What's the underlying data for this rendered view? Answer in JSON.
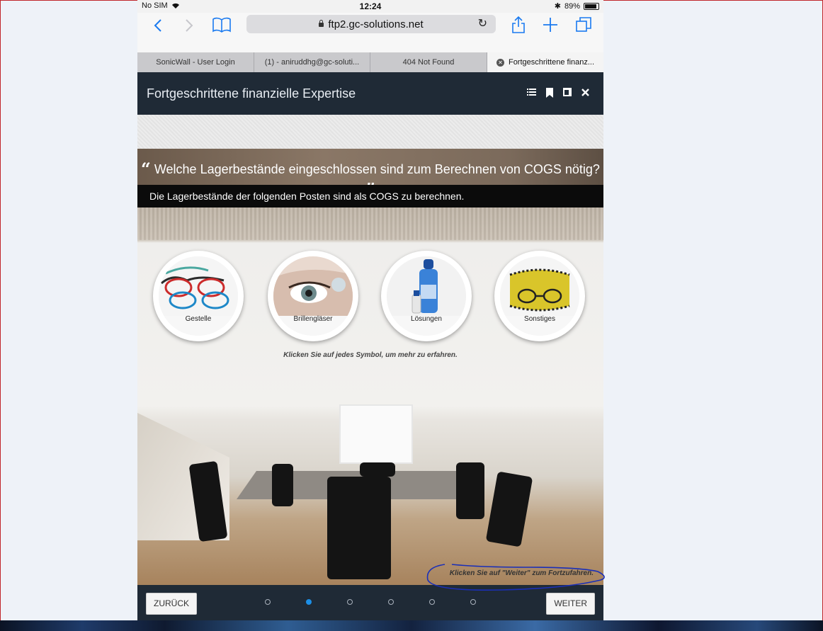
{
  "status": {
    "carrier": "No SIM",
    "time": "12:24",
    "battery": "89%"
  },
  "browser": {
    "url": "ftp2.gc-solutions.net",
    "tabs": [
      {
        "label": "SonicWall - User Login"
      },
      {
        "label": "(1) - aniruddhg@gc-soluti..."
      },
      {
        "label": "404 Not Found"
      },
      {
        "label": "Fortgeschrittene finanz..."
      }
    ],
    "icons": {
      "back": "chevron-left-icon",
      "forward": "chevron-right-icon",
      "bookmarks": "book-icon",
      "share": "share-icon",
      "new_tab": "plus-icon",
      "tabs": "tabs-icon",
      "reload": "reload-icon"
    }
  },
  "course": {
    "title": "Fortgeschrittene finanzielle Expertise",
    "header_icons": [
      "list-icon",
      "bookmark-icon",
      "page-icon",
      "close-icon"
    ]
  },
  "slide": {
    "question": "Welche Lagerbestände eingeschlossen sind zum Berechnen von COGS nötig?",
    "subheader": "Die Lagerbestände der folgenden Posten sind als COGS zu berechnen.",
    "items": [
      {
        "label": "Gestelle",
        "icon": "eyeglass-frames-icon"
      },
      {
        "label": "Brillengläser",
        "icon": "contact-lens-icon"
      },
      {
        "label": "Lösungen",
        "icon": "solution-bottle-icon"
      },
      {
        "label": "Sonstiges",
        "icon": "glasses-case-icon"
      }
    ],
    "hint": "Klicken Sie auf jedes Symbol, um mehr zu erfahren.",
    "continue_hint": "Klicken Sie auf \"Weiter\" zum Fortzufahren."
  },
  "footer": {
    "back_label": "ZURÜCK",
    "next_label": "WEITER",
    "pages": 6,
    "current_page": 2
  },
  "colors": {
    "accent": "#1c8fe6",
    "header_bg": "#1f2a36",
    "annotation": "#1a2fb8"
  }
}
